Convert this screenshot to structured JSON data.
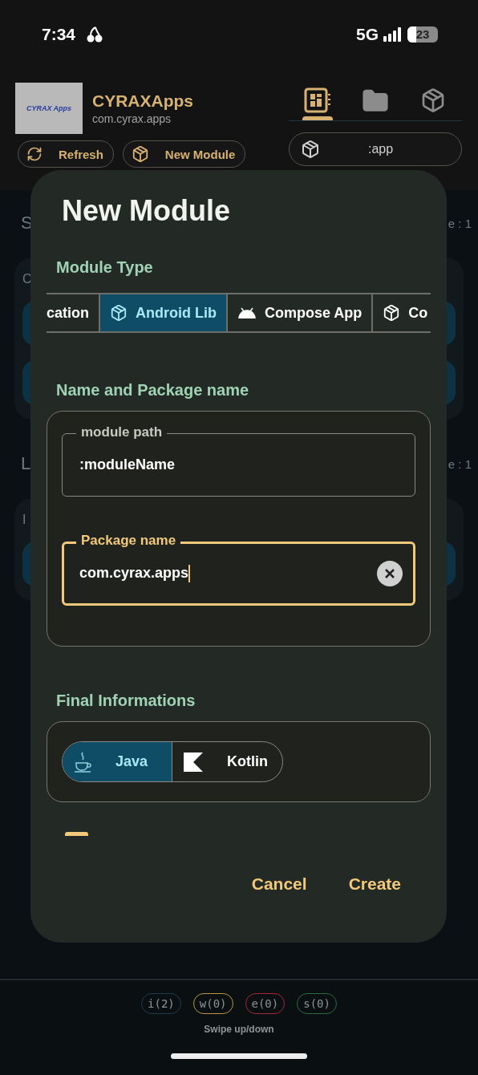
{
  "status_bar": {
    "time": "7:34",
    "network": "5G",
    "battery": "23"
  },
  "app": {
    "logo_text": "CYRAX Apps",
    "name": "CYRAXApps",
    "package": "com.cyrax.apps"
  },
  "actions": [
    {
      "label": "Refresh",
      "kind": "refresh"
    },
    {
      "label": "New Module",
      "kind": "module"
    }
  ],
  "view_tabs": [
    {
      "kind": "board",
      "selected": true
    },
    {
      "kind": "folder",
      "selected": false
    },
    {
      "kind": "module",
      "selected": false
    }
  ],
  "module_selector": {
    "value": ":app"
  },
  "background_sections": [
    {
      "heading": "S",
      "trailing": "e : 1",
      "card_text": "C"
    },
    {
      "heading": "L",
      "trailing": "e : 1",
      "card_text": "I"
    }
  ],
  "dialog": {
    "title": "New Module",
    "module_type": {
      "label": "Module Type",
      "options": [
        {
          "label": "cation",
          "kind": "clipped",
          "selected": false
        },
        {
          "label": "Android Lib",
          "kind": "cube",
          "selected": true
        },
        {
          "label": "Compose App",
          "kind": "android",
          "selected": false
        },
        {
          "label": "Co",
          "kind": "cube",
          "selected": false
        }
      ]
    },
    "name_section": {
      "label": "Name and Package name",
      "fields": [
        {
          "label": "module path",
          "value": ":moduleName",
          "focused": false
        },
        {
          "label": "Package name",
          "value": "com.cyrax.apps",
          "focused": true
        }
      ]
    },
    "final_section": {
      "label": "Final Informations",
      "languages": [
        {
          "label": "Java",
          "kind": "java",
          "selected": true
        },
        {
          "label": "Kotlin",
          "kind": "kotlin",
          "selected": false
        }
      ]
    },
    "buttons": [
      {
        "label": "Cancel"
      },
      {
        "label": "Create"
      }
    ]
  },
  "log_chips": [
    {
      "label": "i(2)",
      "color": "#1f3b4b"
    },
    {
      "label": "w(0)",
      "color": "#b8963e"
    },
    {
      "label": "e(0)",
      "color": "#a3283a"
    },
    {
      "label": "s(0)",
      "color": "#2d6b3e"
    }
  ],
  "hint": "Swipe up/down"
}
